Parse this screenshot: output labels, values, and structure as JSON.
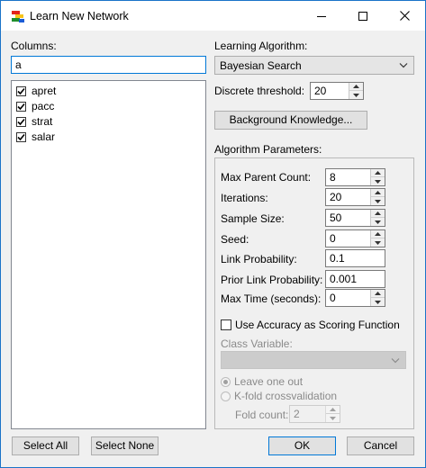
{
  "window": {
    "title": "Learn New Network",
    "minimize_icon": "minimize-icon",
    "maximize_icon": "maximize-icon",
    "close_icon": "close-icon",
    "app_icon": "network-app-icon"
  },
  "columns": {
    "label": "Columns:",
    "filter_value": "a",
    "items": [
      {
        "label": "apret",
        "checked": true
      },
      {
        "label": "pacc",
        "checked": true
      },
      {
        "label": "strat",
        "checked": true
      },
      {
        "label": "salar",
        "checked": true
      }
    ]
  },
  "algorithm": {
    "label": "Learning Algorithm:",
    "selected": "Bayesian Search",
    "discrete_threshold_label": "Discrete threshold:",
    "discrete_threshold_value": "20",
    "background_knowledge_label": "Background Knowledge..."
  },
  "params": {
    "label": "Algorithm Parameters:",
    "max_parent_count_label": "Max Parent Count:",
    "max_parent_count_value": "8",
    "iterations_label": "Iterations:",
    "iterations_value": "20",
    "sample_size_label": "Sample Size:",
    "sample_size_value": "50",
    "seed_label": "Seed:",
    "seed_value": "0",
    "link_probability_label": "Link Probability:",
    "link_probability_value": "0.1",
    "prior_link_probability_label": "Prior Link Probability:",
    "prior_link_probability_value": "0.001",
    "max_time_label": "Max Time (seconds):",
    "max_time_value": "0",
    "use_accuracy_label": "Use Accuracy as Scoring Function",
    "use_accuracy_checked": false,
    "class_variable_label": "Class Variable:",
    "class_variable_value": "",
    "leave_one_out_label": "Leave one out",
    "kfold_label": "K-fold crossvalidation",
    "fold_count_label": "Fold count:",
    "fold_count_value": "2"
  },
  "footer": {
    "select_all": "Select All",
    "select_none": "Select None",
    "ok": "OK",
    "cancel": "Cancel"
  }
}
